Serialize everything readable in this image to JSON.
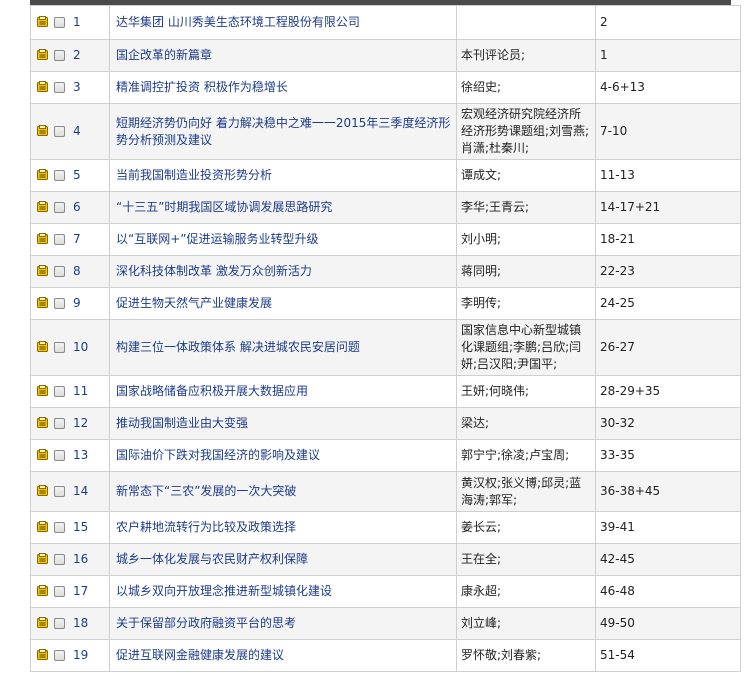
{
  "rows": [
    {
      "num": "1",
      "title": "达华集团 山川秀美生态环境工程股份有限公司",
      "author": "",
      "pages": "2"
    },
    {
      "num": "2",
      "title": "国企改革的新篇章",
      "author": "本刊评论员;",
      "pages": "1"
    },
    {
      "num": "3",
      "title": "精准调控扩投资 积极作为稳增长",
      "author": "徐绍史;",
      "pages": "4-6+13"
    },
    {
      "num": "4",
      "title": "短期经济势仍向好 着力解决稳中之难一一2015年三季度经济形势分析预测及建议",
      "author": "宏观经济研究院经济所经济形势课题组;刘雪燕;肖潇;杜秦川;",
      "pages": "7-10"
    },
    {
      "num": "5",
      "title": "当前我国制造业投资形势分析",
      "author": "谭成文;",
      "pages": "11-13"
    },
    {
      "num": "6",
      "title": "“十三五”时期我国区域协调发展思路研究",
      "author": "李华;王青云;",
      "pages": "14-17+21"
    },
    {
      "num": "7",
      "title": "以“互联网+”促进运输服务业转型升级",
      "author": "刘小明;",
      "pages": "18-21"
    },
    {
      "num": "8",
      "title": "深化科技体制改革 激发万众创新活力",
      "author": "蒋同明;",
      "pages": "22-23"
    },
    {
      "num": "9",
      "title": "促进生物天然气产业健康发展",
      "author": "李明传;",
      "pages": "24-25"
    },
    {
      "num": "10",
      "title": "构建三位一体政策体系 解决进城农民安居问题",
      "author": "国家信息中心新型城镇化课题组;李鹏;吕欣;闫妍;吕汉阳;尹国平;",
      "pages": "26-27"
    },
    {
      "num": "11",
      "title": "国家战略储备应积极开展大数据应用",
      "author": "王妍;何晓伟;",
      "pages": "28-29+35"
    },
    {
      "num": "12",
      "title": "推动我国制造业由大变强",
      "author": "梁达;",
      "pages": "30-32"
    },
    {
      "num": "13",
      "title": "国际油价下跌对我国经济的影响及建议",
      "author": "郭宁宁;徐凌;卢宝周;",
      "pages": "33-35"
    },
    {
      "num": "14",
      "title": "新常态下“三农”发展的一次大突破",
      "author": "黄汉权;张义博;邱灵;蓝海涛;郭军;",
      "pages": "36-38+45"
    },
    {
      "num": "15",
      "title": "农户耕地流转行为比较及政策选择",
      "author": "姜长云;",
      "pages": "39-41"
    },
    {
      "num": "16",
      "title": "城乡一体化发展与农民财产权利保障",
      "author": "王在全;",
      "pages": "42-45"
    },
    {
      "num": "17",
      "title": "以城乡双向开放理念推进新型城镇化建设",
      "author": "康永超;",
      "pages": "46-48"
    },
    {
      "num": "18",
      "title": "关于保留部分政府融资平台的思考",
      "author": "刘立峰;",
      "pages": "49-50"
    },
    {
      "num": "19",
      "title": "促进互联网金融健康发展的建议",
      "author": "罗怀敬;刘春紫;",
      "pages": "51-54"
    }
  ],
  "colors": {
    "link": "#1c3b8a",
    "icon": "#e6b800",
    "border": "#cfcfcf",
    "topbar": "#4a4a4a"
  },
  "icons": {
    "row_icon": "folder-document-icon",
    "row_select": "checkbox"
  }
}
